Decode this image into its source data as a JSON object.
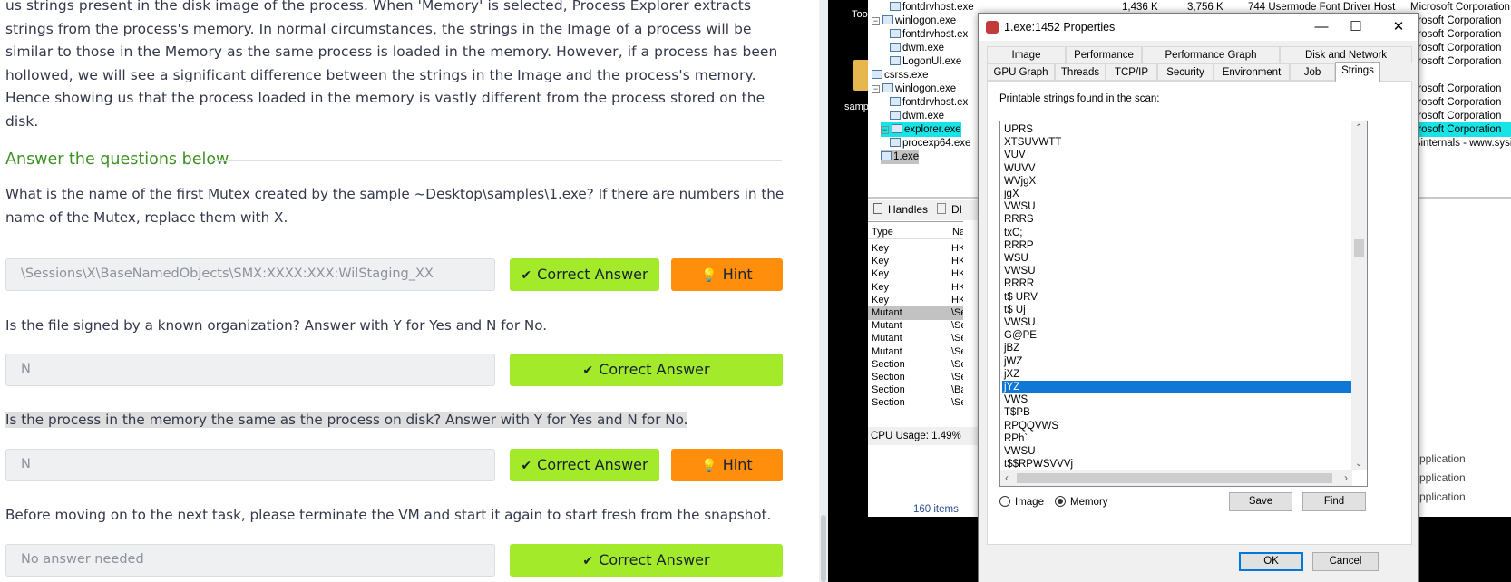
{
  "intro": {
    "text": "us strings present in the disk image of the process. When 'Memory' is selected, Process Explorer extracts strings from the process's memory. In normal circumstances, the strings in the Image of a process will be similar to those in the Memory as the same process is loaded in the memory. However, if a  process has been hollowed, we will see a significant difference between the strings in the Image and the process's memory. Hence showing us that the process loaded in the memory is vastly different from the process stored on the disk."
  },
  "section": {
    "title": "Answer the questions below"
  },
  "questions": [
    {
      "text": "What is the name of the first Mutex created by the sample ~Desktop\\samples\\1.exe? If there are numbers in the name of the Mutex, replace them with X.",
      "answer": "\\Sessions\\X\\BaseNamedObjects\\SMX:XXXX:XXX:WilStaging_XX",
      "correct_label": "Correct Answer",
      "hint_label": "Hint"
    },
    {
      "text": "Is the file signed by a known organization? Answer with Y for Yes and N for No.",
      "answer": "N",
      "correct_label": "Correct Answer"
    },
    {
      "text": "Is the process in the memory the same as the process on disk? Answer with Y for Yes and N for No.",
      "answer": "N",
      "correct_label": "Correct Answer",
      "hint_label": "Hint"
    },
    {
      "text": "Before moving on to the next task, please terminate the VM and start it again to start fresh from the snapshot.",
      "answer": "No answer needed",
      "correct_label": "Correct Answer"
    }
  ],
  "icons": {
    "check": "check-icon",
    "hint": "lightbulb-icon"
  },
  "colors": {
    "accent_green": "#a3ea2a",
    "hint_orange": "#ff8e0c",
    "title_green": "#3d9122",
    "selection_cyan": "#17e4e6",
    "selection_blue": "#0f78d7"
  },
  "vm": {
    "desktop": {
      "label1": "Too",
      "label2": "samp"
    },
    "process_tree": [
      {
        "name": "fontdrvhost.exe",
        "indent": 2
      },
      {
        "name": "winlogon.exe",
        "indent": 1,
        "expander": "−"
      },
      {
        "name": "fontdrvhost.ex",
        "indent": 2
      },
      {
        "name": "dwm.exe",
        "indent": 2
      },
      {
        "name": "LogonUI.exe",
        "indent": 2
      },
      {
        "name": "csrss.exe",
        "indent": 1
      },
      {
        "name": "winlogon.exe",
        "indent": 1,
        "expander": "−"
      },
      {
        "name": "fontdrvhost.ex",
        "indent": 2
      },
      {
        "name": "dwm.exe",
        "indent": 2
      },
      {
        "name": "explorer.exe",
        "indent": 1,
        "expander": "−",
        "highlight": "cyan"
      },
      {
        "name": "procexp64.exe",
        "indent": 2
      },
      {
        "name": "1.exe",
        "indent": 1,
        "highlight": "gray"
      }
    ],
    "top_row_values": {
      "private": "1,436 K",
      "working": "3,756 K",
      "pid_desc": "744 Usermode Font Driver Host"
    },
    "company_column": [
      "Microsoft Corporation",
      "icrosoft Corporation",
      "icrosoft Corporation",
      "icrosoft Corporation",
      "icrosoft Corporation",
      "",
      "icrosoft Corporation",
      "icrosoft Corporation",
      "icrosoft Corporation",
      "icrosoft Corporation",
      "ysinternals - www.sysin",
      ""
    ],
    "handles": {
      "tab1": "Handles",
      "tab2": "DI",
      "col_type": "Type",
      "col_name": "Na",
      "rows": [
        {
          "type": "Key",
          "name": "HK"
        },
        {
          "type": "Key",
          "name": "HK"
        },
        {
          "type": "Key",
          "name": "HK"
        },
        {
          "type": "Key",
          "name": "HK"
        },
        {
          "type": "Key",
          "name": "HK"
        },
        {
          "type": "Mutant",
          "name": "\\Se",
          "selected": true
        },
        {
          "type": "Mutant",
          "name": "\\Se"
        },
        {
          "type": "Mutant",
          "name": "\\Se"
        },
        {
          "type": "Mutant",
          "name": "\\Se"
        },
        {
          "type": "Section",
          "name": "\\Se"
        },
        {
          "type": "Section",
          "name": "\\Se"
        },
        {
          "type": "Section",
          "name": "\\Ba"
        },
        {
          "type": "Section",
          "name": "\\Se"
        }
      ]
    },
    "status": {
      "cpu": "CPU Usage: 1.49%",
      "items": "160 items"
    },
    "category_column": [
      "Application",
      "Application",
      "Application"
    ],
    "dialog": {
      "title": "1.exe:1452 Properties",
      "controls": {
        "minimize": "—",
        "maximize": "☐",
        "close": "✕"
      },
      "tabs_row1": [
        "Image",
        "Performance",
        "Performance Graph",
        "Disk and Network"
      ],
      "tabs_row2": [
        "GPU Graph",
        "Threads",
        "TCP/IP",
        "Security",
        "Environment",
        "Job",
        "Strings"
      ],
      "active_tab": "Strings",
      "strings_label": "Printable strings found in the scan:",
      "strings": [
        "UPRS",
        "XTSUVWTT",
        "VUV",
        "WUVV",
        "WVjgX",
        "jgX",
        "VWSU",
        "RRRS",
        "txC;",
        "RRRP",
        "WSU",
        "VWSU",
        "RRRR",
        "t$ URV",
        "t$ Uj",
        "VWSU",
        "G@PE",
        "jBZ",
        "jWZ",
        "jXZ",
        "jYZ",
        "VWS",
        "T$PB",
        "RPQQVWS",
        "RPh`",
        "VWSU",
        "t$$RPWSVVVj"
      ],
      "selected_string_index": 20,
      "radio_image": "Image",
      "radio_memory": "Memory",
      "radio_selected": "Memory",
      "save_label": "Save",
      "find_label": "Find",
      "ok_label": "OK",
      "cancel_label": "Cancel"
    }
  }
}
